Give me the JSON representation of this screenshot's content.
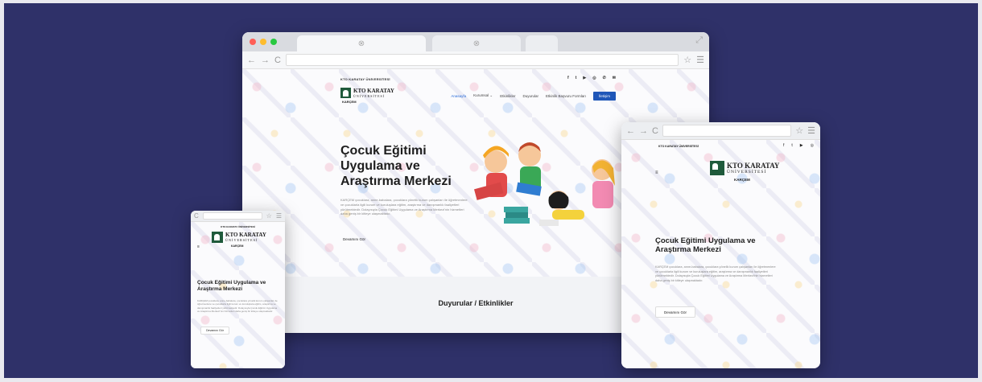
{
  "site": {
    "university_small": "KTO KARATAY ÜNİVERSİTESİ",
    "logo_name": "KTO KARATAY",
    "logo_sub": "ÜNİVERSİTESİ",
    "unit": "KARÇEM",
    "hero_title": "Çocuk Eğitimi Uygulama ve Araştırma Merkezi",
    "hero_text": "KARÇEM çocuklara, anne-babalara, çocuklara yönelik kurum çalışanları ile öğretmenlere ve çocuklarla ilgili kurum ve kuruluşlara eğitim, araştırma ve danışmanlık faaliyetleri yürütmektedir. Dolayısıyla Çocuk Eğitimi Uygulama ve Araştırma Merkezi'nin hizmetleri daha geniş bir kitleye ulaşmaktadır.",
    "cta": "Devamını Gör",
    "section_title": "Duyurular / Etkinlikler"
  },
  "nav": {
    "items": [
      "Anasayfa",
      "Kurumsal",
      "Etkinlikler",
      "Duyurular",
      "Etkinlik Başvuru Formları"
    ],
    "contact": "İletişim"
  },
  "icons": {
    "social": [
      "facebook-icon",
      "twitter-icon",
      "youtube-icon",
      "instagram-icon",
      "phone-icon",
      "mail-icon"
    ],
    "social_glyphs": [
      "f",
      "t",
      "▶",
      "◎",
      "✆",
      "✉"
    ]
  },
  "colors": {
    "background": "#2f3169",
    "accent_blue": "#1f56b8",
    "logo_green": "#1f5a3b"
  }
}
